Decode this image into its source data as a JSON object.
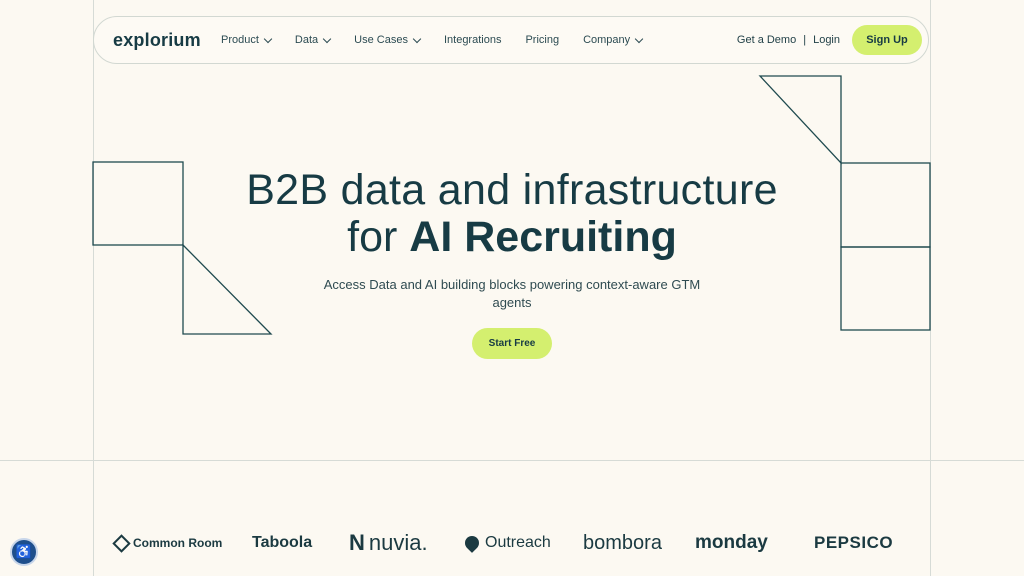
{
  "header": {
    "logo": "explorium",
    "nav": [
      {
        "label": "Product",
        "dropdown": true
      },
      {
        "label": "Data",
        "dropdown": true
      },
      {
        "label": "Use Cases",
        "dropdown": true
      },
      {
        "label": "Integrations",
        "dropdown": false
      },
      {
        "label": "Pricing",
        "dropdown": false
      },
      {
        "label": "Company",
        "dropdown": true
      }
    ],
    "demo": "Get a Demo",
    "separator": "|",
    "login": "Login",
    "signup": "Sign Up"
  },
  "hero": {
    "line1": "B2B data and infrastructure",
    "line2_prefix": "for ",
    "line2_bold": "AI Recruiting",
    "subtitle": "Access Data and AI building blocks powering context-aware GTM agents",
    "cta": "Start Free"
  },
  "customers": [
    "Common Room",
    "Taboola",
    "nuvia.",
    "Outreach",
    "bombora",
    "monday",
    "PEPSICO"
  ],
  "colors": {
    "accent": "#d4ef6f",
    "text": "#173b44",
    "background": "#fcf9f2"
  },
  "icons": {
    "a11y": "accessibility-icon"
  }
}
